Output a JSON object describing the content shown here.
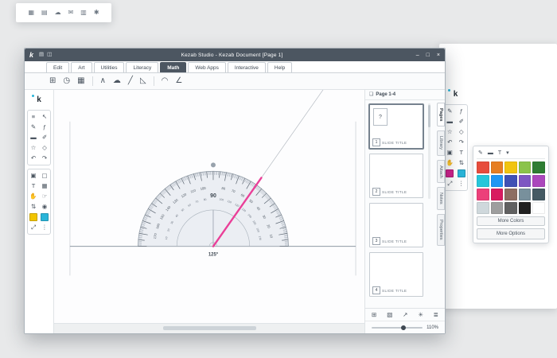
{
  "colors": {
    "titlebar": "#4c5661",
    "accent_cyan": "#2ab5d9",
    "accent_yellow": "#f2c500",
    "accent_magenta": "#d0218c",
    "protractor_line_pink": "#ea3f98"
  },
  "background": {
    "top_left_toolbar": {
      "icons": [
        {
          "name": "grid-icon",
          "glyph": "▦"
        },
        {
          "name": "folder-icon",
          "glyph": "▤"
        },
        {
          "name": "cloud-icon",
          "glyph": "☁"
        },
        {
          "name": "mail-icon",
          "glyph": "✉"
        },
        {
          "name": "chart-icon",
          "glyph": "▥"
        },
        {
          "name": "settings-icon",
          "glyph": "✱"
        }
      ]
    },
    "right_window": {
      "logo_text": "k",
      "toolbar_icons": [
        {
          "name": "pen-icon",
          "glyph": "✎"
        },
        {
          "name": "function-pen-icon",
          "glyph": "ƒ"
        },
        {
          "name": "eraser-icon",
          "glyph": "▬"
        },
        {
          "name": "highlighter-icon",
          "glyph": "✐"
        },
        {
          "name": "star-icon",
          "glyph": "☆"
        },
        {
          "name": "shapes-icon",
          "glyph": "◇"
        },
        {
          "name": "undo-icon",
          "glyph": "↶"
        },
        {
          "name": "redo-icon",
          "glyph": "↷"
        },
        {
          "name": "clone-icon",
          "glyph": "▣"
        },
        {
          "name": "text-icon",
          "glyph": "T"
        },
        {
          "name": "hand-icon",
          "glyph": "✋"
        },
        {
          "name": "sliders-icon",
          "glyph": "⇅"
        },
        {
          "name": "magenta-swatch",
          "color": "#d0218c"
        },
        {
          "name": "cyan-swatch",
          "color": "#2ab5d9"
        },
        {
          "name": "fullscreen-icon",
          "glyph": "⤢"
        },
        {
          "name": "more-icon",
          "glyph": "⋮"
        }
      ],
      "popover": {
        "header_icons": [
          {
            "name": "pen-icon",
            "glyph": "✎"
          },
          {
            "name": "eraser-icon",
            "glyph": "▬"
          },
          {
            "name": "text-icon",
            "glyph": "T"
          },
          {
            "name": "chevron-down-icon",
            "glyph": "▾"
          }
        ],
        "colors": [
          "#e74c3c",
          "#e67e22",
          "#f1c40f",
          "#8bc34a",
          "#2e7d32",
          "#26c6da",
          "#2196f3",
          "#3f51b5",
          "#7e57c2",
          "#ab47bc",
          "#ec407a",
          "#d81b60",
          "#8d6e63",
          "#78909c",
          "#455a64",
          "#cfd8dc",
          "#9e9e9e",
          "#616161",
          "#212121",
          "#ffffff"
        ],
        "more_colors_label": "More Colors",
        "more_options_label": "More Options"
      }
    }
  },
  "window": {
    "logo_text": "k",
    "title": "Kezab Studio - Kezab Document [Page 1]",
    "title_icons": [
      {
        "name": "folder-icon",
        "glyph": "▤"
      },
      {
        "name": "print-icon",
        "glyph": "◫"
      }
    ],
    "controls": [
      {
        "name": "minimize-button",
        "glyph": "–"
      },
      {
        "name": "maximize-button",
        "glyph": "□"
      },
      {
        "name": "close-button",
        "glyph": "×"
      }
    ]
  },
  "menu_tabs": [
    {
      "name": "tab-edit",
      "label": "Edit"
    },
    {
      "name": "tab-art",
      "label": "Art"
    },
    {
      "name": "tab-utilities",
      "label": "Utilities"
    },
    {
      "name": "tab-literacy",
      "label": "Literacy"
    },
    {
      "name": "tab-math",
      "label": "Math",
      "active": true
    },
    {
      "name": "tab-web-apps",
      "label": "Web Apps"
    },
    {
      "name": "tab-interactive",
      "label": "Interactive"
    },
    {
      "name": "tab-help",
      "label": "Help"
    }
  ],
  "math_toolbar": {
    "group1": [
      {
        "name": "calculator-icon",
        "glyph": "⊞"
      },
      {
        "name": "clock-icon",
        "glyph": "◷"
      },
      {
        "name": "table-icon",
        "glyph": "▦"
      }
    ],
    "group2": [
      {
        "name": "compass-icon",
        "glyph": "∧"
      },
      {
        "name": "cloud-icon",
        "glyph": "☁"
      },
      {
        "name": "ruler-icon",
        "glyph": "╱"
      },
      {
        "name": "set-square-icon",
        "glyph": "◺"
      }
    ],
    "group3": [
      {
        "name": "protractor-icon",
        "glyph": "◠"
      },
      {
        "name": "angle-icon",
        "glyph": "∠"
      }
    ]
  },
  "sidebar": {
    "logo_text": "k",
    "group1": [
      {
        "name": "menu-icon",
        "glyph": "≡"
      },
      {
        "name": "select-icon",
        "glyph": "↖"
      },
      {
        "name": "pen-icon",
        "glyph": "✎"
      },
      {
        "name": "function-pen-icon",
        "glyph": "ƒ"
      },
      {
        "name": "eraser-icon",
        "glyph": "▬"
      },
      {
        "name": "highlighter-icon",
        "glyph": "✐"
      },
      {
        "name": "star-icon",
        "glyph": "☆"
      },
      {
        "name": "shapes-icon",
        "glyph": "◇"
      },
      {
        "name": "undo-icon",
        "glyph": "↶"
      },
      {
        "name": "redo-icon",
        "glyph": "↷"
      }
    ],
    "group2": [
      {
        "name": "clone-icon",
        "glyph": "▣"
      },
      {
        "name": "layers-icon",
        "glyph": "▢"
      },
      {
        "name": "text-icon",
        "glyph": "T"
      },
      {
        "name": "media-icon",
        "glyph": "▦"
      },
      {
        "name": "hand-icon",
        "glyph": "✋"
      },
      {
        "name": "pointer-icon",
        "glyph": "☞"
      },
      {
        "name": "sliders-icon",
        "glyph": "⇅"
      },
      {
        "name": "toggle-icon",
        "glyph": "◉"
      },
      {
        "name": "yellow-swatch",
        "color": "#f2c500"
      },
      {
        "name": "cyan-swatch",
        "color": "#2ab5d9"
      },
      {
        "name": "fullscreen-icon",
        "glyph": "⤢"
      },
      {
        "name": "more-icon",
        "glyph": "⋮"
      }
    ]
  },
  "canvas": {
    "protractor": {
      "top_label": "90",
      "reading": "125°",
      "angle_deg": 125,
      "scale_max": 180,
      "number_step": 10
    }
  },
  "pages_panel": {
    "header": {
      "icon_glyph": "❏",
      "label": "Page 1-4"
    },
    "slides": [
      {
        "number": "1",
        "title": "SLIDE TITLE",
        "selected": true,
        "badge": "?"
      },
      {
        "number": "2",
        "title": "SLIDE TITLE"
      },
      {
        "number": "3",
        "title": "SLIDE TITLE"
      },
      {
        "number": "4",
        "title": "SLIDE TITLE"
      }
    ],
    "tabs": [
      {
        "name": "tab-pages",
        "label": "Pages",
        "active": true
      },
      {
        "name": "tab-library",
        "label": "Library"
      },
      {
        "name": "tab-attach",
        "label": "Attach"
      },
      {
        "name": "tab-notes",
        "label": "Notes"
      },
      {
        "name": "tab-properties",
        "label": "Properties"
      }
    ],
    "footer_icons": [
      {
        "name": "add-page-icon",
        "glyph": "⊞"
      },
      {
        "name": "duplicate-page-icon",
        "glyph": "▧"
      },
      {
        "name": "export-icon",
        "glyph": "↗"
      },
      {
        "name": "effects-icon",
        "glyph": "✳"
      },
      {
        "name": "list-view-icon",
        "glyph": "≣"
      }
    ],
    "zoom": {
      "value": "110%",
      "percent": 62
    }
  }
}
